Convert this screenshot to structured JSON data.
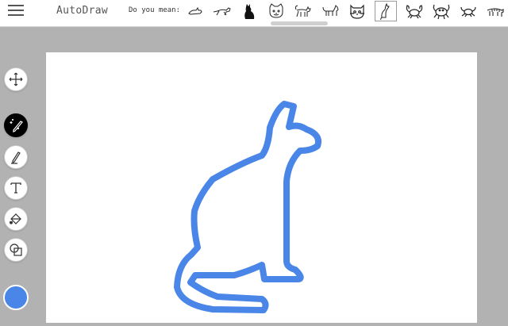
{
  "app": {
    "title": "AutoDraw"
  },
  "suggestions": {
    "label": "Do you mean:",
    "items": [
      {
        "icon": "cat-lying-icon"
      },
      {
        "icon": "cat-running-icon"
      },
      {
        "icon": "black-cat-icon"
      },
      {
        "icon": "cat-face-icon"
      },
      {
        "icon": "cat-walking-icon"
      },
      {
        "icon": "cat-standing-icon"
      },
      {
        "icon": "cat-head-icon"
      },
      {
        "icon": "cat-sitting-icon",
        "selected": true
      },
      {
        "icon": "crab-icon"
      },
      {
        "icon": "crab-outline-icon"
      },
      {
        "icon": "crab-small-icon"
      },
      {
        "icon": "tiger-icon"
      }
    ]
  },
  "tools": [
    {
      "name": "move-tool",
      "icon": "move-icon"
    },
    {
      "name": "autodraw-tool",
      "icon": "magic-pencil-icon",
      "active": true
    },
    {
      "name": "draw-tool",
      "icon": "pencil-icon"
    },
    {
      "name": "type-tool",
      "icon": "text-icon"
    },
    {
      "name": "fill-tool",
      "icon": "paint-bucket-icon"
    },
    {
      "name": "shape-tool",
      "icon": "shapes-icon"
    }
  ],
  "colors": {
    "current": "#4a86e8",
    "stroke": "#4a86e8"
  },
  "drawing": {
    "subject": "cat-sitting"
  }
}
